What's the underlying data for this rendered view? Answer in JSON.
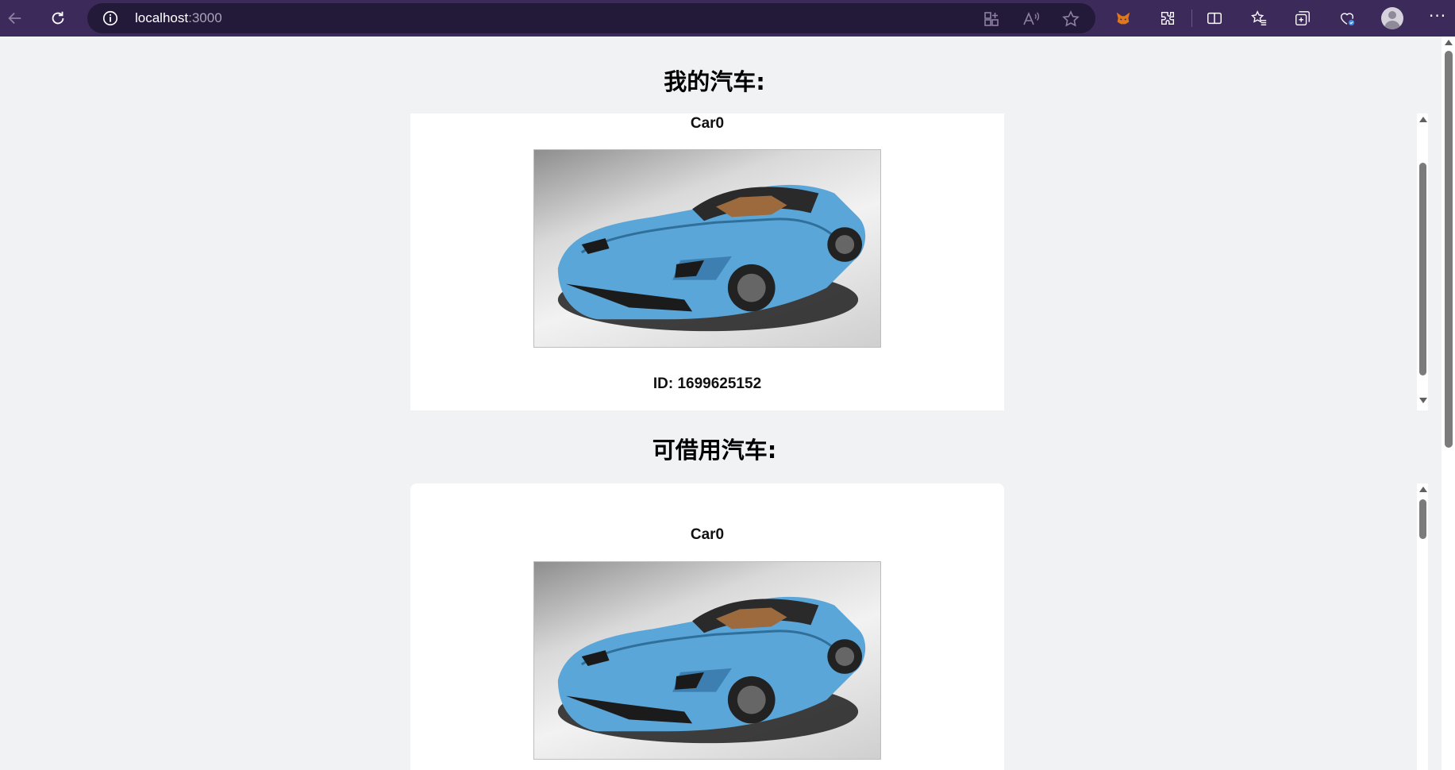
{
  "browser": {
    "url_host": "localhost",
    "url_port": ":3000",
    "accent_color": "#3c2a5b"
  },
  "page": {
    "my_cars_title": "我的汽车:",
    "available_cars_title": "可借用汽车:"
  },
  "my_cars": [
    {
      "name": "Car0",
      "id_label": "ID: 1699625152",
      "image": "blue-convertible-sports-car"
    }
  ],
  "available_cars": [
    {
      "name": "Car0",
      "image": "blue-convertible-sports-car"
    }
  ],
  "icons": [
    "back-arrow-icon",
    "refresh-icon",
    "info-icon",
    "app-grid-icon",
    "read-aloud-icon",
    "favorite-star-icon",
    "metamask-fox-icon",
    "extensions-icon",
    "split-screen-icon",
    "favorites-icon",
    "collections-icon",
    "browser-essentials-icon",
    "profile-avatar-icon",
    "more-options-icon"
  ]
}
